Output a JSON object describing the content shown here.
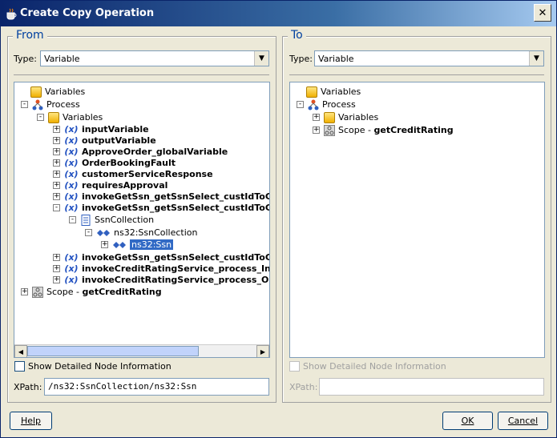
{
  "window": {
    "title": "Create Copy Operation",
    "close": "✕"
  },
  "from": {
    "group_title": "From",
    "type_label": "Type:",
    "type_value": "Variable",
    "tree": [
      {
        "label": "Variables",
        "icon": "folder-icon",
        "bold": false,
        "selected": false
      },
      {
        "label": "Process",
        "icon": "process-icon",
        "bold": false,
        "selected": false
      },
      {
        "label": "Variables",
        "icon": "folder-icon",
        "bold": false,
        "selected": false
      },
      {
        "label": "inputVariable",
        "icon": "variable-icon",
        "bold": true,
        "selected": false
      },
      {
        "label": "outputVariable",
        "icon": "variable-icon",
        "bold": true,
        "selected": false
      },
      {
        "label": "ApproveOrder_globalVariable",
        "icon": "variable-icon",
        "bold": true,
        "selected": false
      },
      {
        "label": "OrderBookingFault",
        "icon": "variable-icon",
        "bold": true,
        "selected": false
      },
      {
        "label": "customerServiceResponse",
        "icon": "variable-icon",
        "bold": true,
        "selected": false
      },
      {
        "label": "requiresApproval",
        "icon": "variable-icon",
        "bold": true,
        "selected": false
      },
      {
        "label": "invokeGetSsn_getSsnSelect_custIdToGetSsn",
        "icon": "variable-icon",
        "bold": true,
        "selected": false
      },
      {
        "label": "invokeGetSsn_getSsnSelect_custIdToGetSsn",
        "icon": "variable-icon",
        "bold": true,
        "selected": false
      },
      {
        "label": "SsnCollection",
        "icon": "document-icon",
        "bold": false,
        "selected": false
      },
      {
        "label": "ns32:SsnCollection",
        "icon": "element-icon",
        "bold": false,
        "selected": false
      },
      {
        "label": "ns32:Ssn",
        "icon": "element-icon",
        "bold": false,
        "selected": true
      },
      {
        "label": "invokeGetSsn_getSsnSelect_custIdToGetSsn",
        "icon": "variable-icon",
        "bold": true,
        "selected": false
      },
      {
        "label": "invokeCreditRatingService_process_InputVariable",
        "icon": "variable-icon",
        "bold": true,
        "selected": false
      },
      {
        "label": "invokeCreditRatingService_process_OutputVariable",
        "icon": "variable-icon",
        "bold": true,
        "selected": false
      },
      {
        "label_prefix": "Scope - ",
        "label": "getCreditRating",
        "icon": "scope-icon",
        "bold": false,
        "selected": false
      }
    ],
    "show_detail_label": "Show Detailed Node Information",
    "xpath_label": "XPath:",
    "xpath_value": "/ns32:SsnCollection/ns32:Ssn"
  },
  "to": {
    "group_title": "To",
    "type_label": "Type:",
    "type_value": "Variable",
    "tree": [
      {
        "label": "Variables",
        "icon": "folder-icon"
      },
      {
        "label": "Process",
        "icon": "process-icon"
      },
      {
        "label": "Variables",
        "icon": "folder-icon"
      },
      {
        "label_prefix": "Scope - ",
        "label": "getCreditRating",
        "icon": "scope-icon"
      }
    ],
    "show_detail_label": "Show Detailed Node Information",
    "xpath_label": "XPath:",
    "xpath_value": ""
  },
  "buttons": {
    "help": "Help",
    "ok": "OK",
    "cancel": "Cancel"
  },
  "colors": {
    "title_bar": "#0a246a",
    "selection": "#316ac5",
    "group_title": "#0040a0"
  }
}
